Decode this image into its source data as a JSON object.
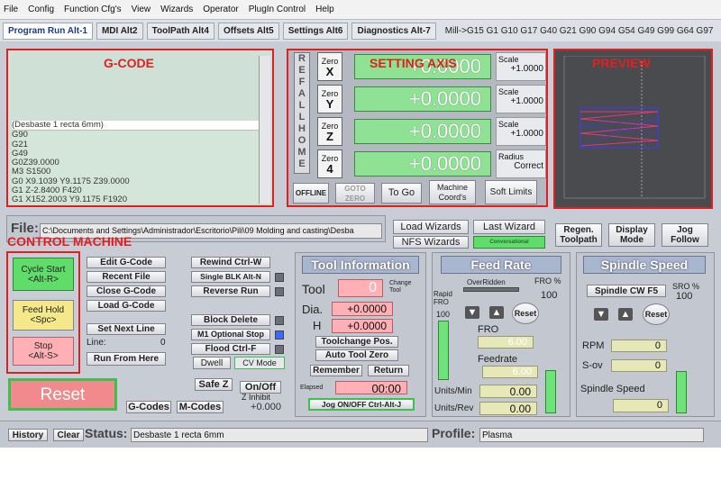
{
  "menu": [
    "File",
    "Config",
    "Function Cfg's",
    "View",
    "Wizards",
    "Operator",
    "PlugIn Control",
    "Help"
  ],
  "tabs": [
    "Program Run Alt-1",
    "MDI Alt2",
    "ToolPath Alt4",
    "Offsets Alt5",
    "Settings Alt6",
    "Diagnostics Alt-7"
  ],
  "active_gcodes": "Mill->G15  G1 G10 G17 G40 G21 G90 G94 G54 G49 G99 G64 G97",
  "labels": {
    "gcode": "G-CODE",
    "axis": "SETTING AXIS",
    "preview": "PREVIEW",
    "control": "CONTROL MACHINE"
  },
  "gcode_lines": [
    "(Desbaste 1 recta 6mm)",
    "G90",
    "G21",
    "G49",
    "G0Z39.0000",
    "M3 S1500",
    "G0 X9.1039 Y9.1175 Z39.0000",
    "G1  Z-2.8400 F420",
    "G1 X152.2003 Y9.1175  F1920"
  ],
  "ref_all_home": [
    "R",
    "E",
    "F",
    "A",
    "L",
    "L",
    "H",
    "O",
    "M",
    "E"
  ],
  "axes": [
    {
      "zero": "Zero",
      "name": "X",
      "value": "+0.0000",
      "scale_label": "Scale",
      "scale": "+1.0000"
    },
    {
      "zero": "Zero",
      "name": "Y",
      "value": "+0.0000",
      "scale_label": "Scale",
      "scale": "+1.0000"
    },
    {
      "zero": "Zero",
      "name": "Z",
      "value": "+0.0000",
      "scale_label": "Scale",
      "scale": "+1.0000"
    },
    {
      "zero": "Zero",
      "name": "4",
      "value": "+0.0000",
      "scale_label": "Radius",
      "scale": "Correct"
    }
  ],
  "axis_buttons": {
    "offline": "OFFLINE",
    "goto_zero": "GOTO ZERO",
    "to_go": "To Go",
    "machine_coords": "Machine Coord's",
    "soft_limits": "Soft Limits"
  },
  "file": {
    "label": "File:",
    "path": "C:\\Documents and Settings\\Administrador\\Escritorio\\Pili\\09 Molding and casting\\Desba"
  },
  "wizards": {
    "load": "Load Wizards",
    "last": "Last Wizard",
    "nfs": "NFS Wizards",
    "bar": "Conversational"
  },
  "view": {
    "regen": "Regen. Toolpath",
    "display": "Display Mode",
    "jog": "Jog Follow"
  },
  "control": {
    "cycle": "Cycle Start <Alt-R>",
    "feedhold": "Feed Hold <Spc>",
    "stop": "Stop <Alt-S>",
    "reset": "Reset"
  },
  "edit": {
    "edit": "Edit G-Code",
    "recent": "Recent File",
    "close": "Close G-Code",
    "load": "Load G-Code",
    "setnext": "Set Next Line",
    "line_label": "Line:",
    "line_val": "0",
    "runfrom": "Run From Here"
  },
  "rewind": {
    "rewind": "Rewind Ctrl-W",
    "single": "Single BLK Alt-N",
    "reverse": "Reverse Run",
    "block": "Block Delete",
    "m1": "M1 Optional Stop",
    "flood": "Flood Ctrl-F",
    "dwell": "Dwell",
    "cv": "CV Mode"
  },
  "bottom_left": {
    "safez": "Safe Z",
    "onoff": "On/Off",
    "zinhibit": "Z Inhibit",
    "zval": "+0.000",
    "gcodes": "G-Codes",
    "mcodes": "M-Codes"
  },
  "tool": {
    "title": "Tool Information",
    "tool_label": "Tool",
    "tool_val": "0",
    "change": "Change Tool",
    "dia_label": "Dia.",
    "dia_val": "+0.0000",
    "h_label": "H",
    "h_val": "+0.0000",
    "toolchange": "Toolchange Pos.",
    "autozero": "Auto Tool Zero",
    "remember": "Remember",
    "return": "Return",
    "elapsed_label": "Elapsed",
    "elapsed": "00:00",
    "jog": "Jog ON/OFF Ctrl-Alt-J"
  },
  "feed": {
    "title": "Feed Rate",
    "overridden": "OverRidden",
    "fro_pct_label": "FRO %",
    "fro_pct": "100",
    "rapid": "Rapid FRO",
    "rapid_val": "100",
    "reset": "Reset",
    "fro_label": "FRO",
    "fro_val": "6.00",
    "feedrate_label": "Feedrate",
    "feedrate_val": "6.00",
    "upm_label": "Units/Min",
    "upm_val": "0.00",
    "upr_label": "Units/Rev",
    "upr_val": "0.00"
  },
  "spindle": {
    "title": "Spindle Speed",
    "cw": "Spindle CW F5",
    "sro_label": "SRO %",
    "sro_val": "100",
    "reset": "Reset",
    "rpm_label": "RPM",
    "rpm_val": "0",
    "sov_label": "S-ov",
    "sov_val": "0",
    "speed_label": "Spindle Speed",
    "speed_val": "0"
  },
  "status": {
    "history": "History",
    "clear": "Clear",
    "label": "Status:",
    "text": "Desbaste 1 recta 6mm",
    "profile_label": "Profile:",
    "profile": "Plasma"
  }
}
